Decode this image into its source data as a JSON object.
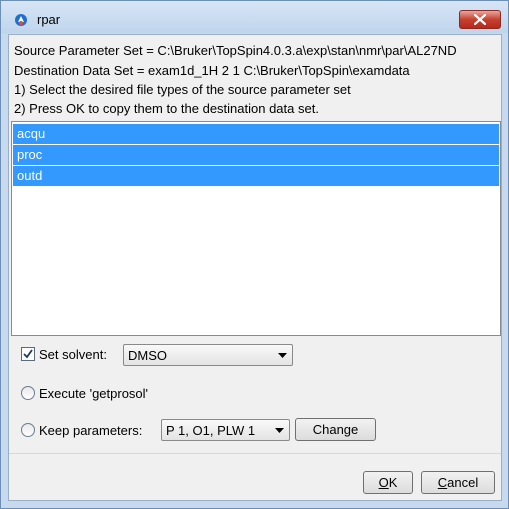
{
  "window": {
    "title": "rpar",
    "icon": "topspin-app-icon",
    "close_icon": "close-icon"
  },
  "info": {
    "line1": "Source Parameter Set = C:\\Bruker\\TopSpin4.0.3.a\\exp\\stan\\nmr\\par\\AL27ND",
    "line2": "Destination Data Set = exam1d_1H  2  1  C:\\Bruker\\TopSpin\\examdata",
    "line3": "1) Select the desired file types of the source parameter set",
    "line4": "2) Press OK to copy them to the destination data set."
  },
  "file_list": {
    "items": [
      {
        "label": "acqu",
        "selected": true
      },
      {
        "label": "proc",
        "selected": true
      },
      {
        "label": "outd",
        "selected": true
      }
    ]
  },
  "options": {
    "set_solvent": {
      "label": "Set solvent:",
      "checked": true,
      "value": "DMSO"
    },
    "execute_getprosol": {
      "label": "Execute 'getprosol'",
      "selected": false
    },
    "keep_parameters": {
      "label": "Keep parameters:",
      "selected": false,
      "value": "P 1, O1, PLW 1",
      "change_label": "Change"
    }
  },
  "buttons": {
    "ok": {
      "label": "OK",
      "mnemonic": "O",
      "rest": "K"
    },
    "cancel": {
      "label": "Cancel",
      "mnemonic": "C",
      "rest": "ancel"
    }
  },
  "colors": {
    "selection": "#3399ff",
    "close_button": "#c7412f",
    "frame": "#c7d9ee"
  }
}
